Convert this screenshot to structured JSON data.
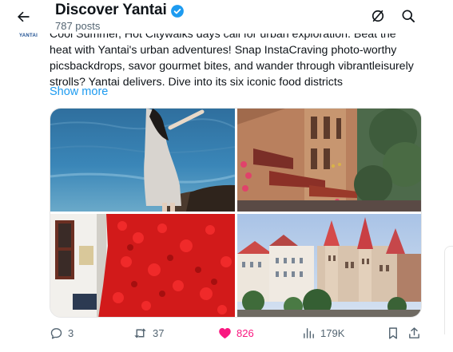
{
  "header": {
    "title": "Discover Yantai",
    "post_count": "787 posts"
  },
  "logo": {
    "text": "YANTAI"
  },
  "tweet": {
    "lines": [
      "Cool Summer, Hot Citywalks days call for urban exploration. Beat the",
      "heat with Yantai's urban adventures! Snap InstaCraving photo-worthy",
      "picsbackdrops, savor gourmet bites, and wander through vibrantleisurely",
      "strolls? Yantai delivers. Dive into its six iconic food districts"
    ],
    "show_more": "Show more"
  },
  "actions": {
    "replies": "3",
    "reposts": "37",
    "likes": "826",
    "views": "179K"
  },
  "colors": {
    "accent": "#1d9bf0",
    "like": "#f91880",
    "muted": "#536471"
  },
  "icons": [
    "back-arrow-icon",
    "verified-badge-icon",
    "grok-icon",
    "search-icon",
    "reply-icon",
    "repost-icon",
    "like-icon",
    "views-icon",
    "bookmark-icon",
    "share-icon"
  ]
}
